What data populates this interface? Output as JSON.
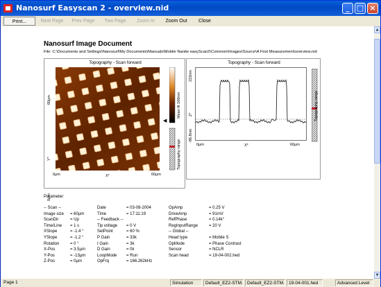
{
  "window": {
    "title": "Nanosurf Easyscan 2 - overview.nid"
  },
  "toolbar": {
    "print": "Print...",
    "next": "Next Page",
    "prev": "Prev Page",
    "two": "Two Page",
    "zoomin": "Zoom In",
    "zoomout": "Zoom Out",
    "close": "Close"
  },
  "doc": {
    "title": "Nanosurf Image Document",
    "file": "File:  C:\\Documents and Settings\\Nanosurf\\My Documents\\Manuals\\Mobile Nanite easyScan2\\Common\\Images\\Source\\A First Measurement\\overview.nid"
  },
  "image_panel": {
    "title": "Topography - Scan forward",
    "y_top": "60µm",
    "y_bottom": "0µm",
    "y_axis": "Y*",
    "x_left": "0µm",
    "x_right": "60µm",
    "x_axis": "X*",
    "colorbar_top": "Mean fit 166nm",
    "colorbar_bottom": "Topography range"
  },
  "profile_panel": {
    "title": "Topography - Scan forward",
    "y_top": "222nm",
    "y_bottom": "-86.8nm",
    "y_axis": "Z*",
    "x_left": "0µm",
    "x_right": "60µm",
    "x_axis": "X*",
    "range_label": "Topography range"
  },
  "params": {
    "title": "Parameter:",
    "col1": [
      [
        "-- Scan --",
        ""
      ],
      [
        "Image size",
        "= 60µm"
      ],
      [
        "ScanDir",
        "= Up"
      ],
      [
        "Time/Line",
        "= 1 s"
      ],
      [
        "XSlope",
        "= -1.4 °"
      ],
      [
        "YSlope",
        "= -1.2 °"
      ],
      [
        "Rotation",
        "= 0 °"
      ],
      [
        "X-Pos",
        "= 3.5µm"
      ],
      [
        "Y-Pos",
        "= -13µm"
      ],
      [
        "Z-Pos",
        "= 0µm"
      ]
    ],
    "col2": [
      [
        "Date",
        "= 03-08-2004"
      ],
      [
        "Time",
        "= 17:11:19"
      ],
      [
        "-- Feedback --",
        ""
      ],
      [
        "Tip voltage",
        "= 0 V"
      ],
      [
        "SetPoint",
        "= 60 %"
      ],
      [
        "P Gain",
        "= 33k"
      ],
      [
        "I Gain",
        "= 3k"
      ],
      [
        "D Gain",
        "= 0k"
      ],
      [
        "LoopMode",
        "= Run"
      ],
      [
        "OpFrq",
        "= 166.262kHz"
      ]
    ],
    "col3": [
      [
        "OpAmp",
        "= 0.25 V"
      ],
      [
        "DriveAmp",
        "= 91mV"
      ],
      [
        "RefPhase",
        "= 0.14k°"
      ],
      [
        "RegInputRange",
        "= 20 V"
      ],
      [
        "-- Global --",
        ""
      ],
      [
        "Head type",
        "= Mobile S"
      ],
      [
        "OpMode",
        "= Phase Contrast"
      ],
      [
        "Sensor",
        "= NCLR"
      ],
      [
        "Scan head",
        "= 19-04-002.hed"
      ]
    ]
  },
  "status": {
    "page": "Page 1",
    "mode": "Simulation",
    "cfg1": "Default_EZ2-STM...",
    "cfg2": "Default_EZ2-STM...",
    "hed": "19-04-001.hed",
    "level": "Advanced Level"
  },
  "colors": {
    "accent": "#0a5fd8",
    "sample_dark": "#5a2200",
    "sample_light": "#fff2d8"
  }
}
